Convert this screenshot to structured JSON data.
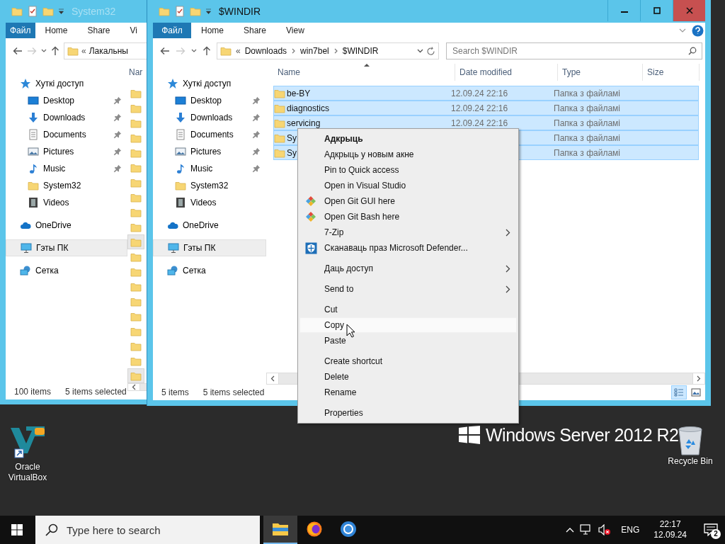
{
  "desktop": {
    "branding": "Windows Server 2012 R2",
    "icons": [
      {
        "label": "Oracle VirtualBox",
        "kind": "virtualbox"
      },
      {
        "label": "Recycle Bin",
        "kind": "bin"
      }
    ]
  },
  "windows": [
    {
      "title": "System32",
      "active": false,
      "help_button": false,
      "ribbon_tabs": [
        {
          "label": "Файл",
          "kind": "file"
        },
        {
          "label": "Home",
          "kind": "tab"
        },
        {
          "label": "Share",
          "kind": "tab"
        },
        {
          "label": "Vi",
          "kind": "tab"
        }
      ],
      "address": {
        "overflow": "«",
        "crumbs": [
          "Лакальны"
        ]
      },
      "nav": [
        {
          "label": "Хуткі доступ",
          "kind": "quick",
          "selected": false,
          "pinned": false,
          "children": [
            {
              "label": "Desktop",
              "kind": "desktop",
              "selected": false,
              "pinned": true
            },
            {
              "label": "Downloads",
              "kind": "downloads",
              "selected": false,
              "pinned": true
            },
            {
              "label": "Documents",
              "kind": "documents",
              "selected": false,
              "pinned": true
            },
            {
              "label": "Pictures",
              "kind": "pictures",
              "selected": false,
              "pinned": true
            },
            {
              "label": "Music",
              "kind": "music",
              "selected": false,
              "pinned": true
            },
            {
              "label": "System32",
              "kind": "folder",
              "selected": false,
              "pinned": false
            },
            {
              "label": "Videos",
              "kind": "videos",
              "selected": false,
              "pinned": false
            }
          ]
        },
        {
          "label": "OneDrive",
          "kind": "cloud",
          "selected": false,
          "pinned": false
        },
        {
          "label": "Гэты ПК",
          "kind": "computer",
          "selected": true,
          "pinned": false
        },
        {
          "label": "Сетка",
          "kind": "network",
          "selected": false,
          "pinned": false
        }
      ],
      "columns": [
        {
          "label": "Nar",
          "sorted": false
        }
      ],
      "files": [
        {
          "selected": false
        },
        {
          "selected": false
        },
        {
          "selected": false
        },
        {
          "selected": false
        },
        {
          "selected": false
        },
        {
          "selected": false
        },
        {
          "selected": false
        },
        {
          "selected": false
        },
        {
          "selected": false
        },
        {
          "selected": false
        },
        {
          "selected": true
        },
        {
          "selected": false
        },
        {
          "selected": false
        },
        {
          "selected": false
        },
        {
          "selected": false
        },
        {
          "selected": false
        },
        {
          "selected": false
        },
        {
          "selected": false
        },
        {
          "selected": false
        },
        {
          "selected": true
        }
      ],
      "status": [
        "100 items",
        "5 items selected"
      ]
    },
    {
      "title": "$WINDIR",
      "active": true,
      "help_button": true,
      "controls": [
        {
          "kind": "minimize"
        },
        {
          "kind": "maximize"
        },
        {
          "kind": "close"
        }
      ],
      "ribbon_tabs": [
        {
          "label": "Файл",
          "kind": "file"
        },
        {
          "label": "Home",
          "kind": "tab"
        },
        {
          "label": "Share",
          "kind": "tab"
        },
        {
          "label": "View",
          "kind": "tab"
        }
      ],
      "address": {
        "overflow": "«",
        "crumbs": [
          "Downloads",
          "win7bel",
          "$WINDIR"
        ]
      },
      "search": {
        "placeholder": "Search $WINDIR"
      },
      "nav": [
        {
          "label": "Хуткі доступ",
          "kind": "quick",
          "selected": false,
          "pinned": false,
          "children": [
            {
              "label": "Desktop",
              "kind": "desktop",
              "selected": false,
              "pinned": true
            },
            {
              "label": "Downloads",
              "kind": "downloads",
              "selected": false,
              "pinned": true
            },
            {
              "label": "Documents",
              "kind": "documents",
              "selected": false,
              "pinned": true
            },
            {
              "label": "Pictures",
              "kind": "pictures",
              "selected": false,
              "pinned": true
            },
            {
              "label": "Music",
              "kind": "music",
              "selected": false,
              "pinned": true
            },
            {
              "label": "System32",
              "kind": "folder",
              "selected": false,
              "pinned": false
            },
            {
              "label": "Videos",
              "kind": "videos",
              "selected": false,
              "pinned": false
            }
          ]
        },
        {
          "label": "OneDrive",
          "kind": "cloud",
          "selected": false,
          "pinned": false
        },
        {
          "label": "Гэты ПК",
          "kind": "computer",
          "selected": true,
          "pinned": false
        },
        {
          "label": "Сетка",
          "kind": "network",
          "selected": false,
          "pinned": false
        }
      ],
      "columns": [
        {
          "label": "Name",
          "sorted": true
        },
        {
          "label": "Date modified",
          "sorted": false
        },
        {
          "label": "Type",
          "sorted": false
        },
        {
          "label": "Size",
          "sorted": false
        }
      ],
      "files": [
        {
          "name": "be-BY",
          "date": "12.09.24 22:16",
          "type": "Папка з файламі",
          "selected": true
        },
        {
          "name": "diagnostics",
          "date": "12.09.24 22:16",
          "type": "Папка з файламі",
          "selected": true
        },
        {
          "name": "servicing",
          "date": "12.09.24 22:16",
          "type": "Папка з файламі",
          "selected": true
        },
        {
          "name": "Sy",
          "type": "Папка з файламі",
          "selected": true
        },
        {
          "name": "Sy",
          "type": "Папка з файламі",
          "selected": true
        }
      ],
      "status": [
        "5 items",
        "5 items selected"
      ],
      "views": [
        {
          "kind": "details",
          "selected": true
        },
        {
          "kind": "tiles",
          "selected": false
        }
      ]
    }
  ],
  "context_menu": [
    {
      "label": "Адкрыць",
      "kind": "plain",
      "default": true,
      "submenu": false,
      "highlighted": false
    },
    {
      "label": "Адкрыць у новым акне",
      "kind": "plain",
      "default": false,
      "submenu": false,
      "highlighted": false
    },
    {
      "label": "Pin to Quick access",
      "kind": "plain",
      "default": false,
      "submenu": false,
      "highlighted": false
    },
    {
      "label": "Open in Visual Studio",
      "kind": "plain",
      "default": false,
      "submenu": false,
      "highlighted": false
    },
    {
      "label": "Open Git GUI here",
      "kind": "git",
      "default": false,
      "submenu": false,
      "highlighted": false
    },
    {
      "label": "Open Git Bash here",
      "kind": "git",
      "default": false,
      "submenu": false,
      "highlighted": false
    },
    {
      "label": "7-Zip",
      "kind": "plain",
      "default": false,
      "submenu": true,
      "highlighted": false
    },
    {
      "label": "Сканаваць праз Microsoft Defender...",
      "kind": "shield",
      "default": false,
      "submenu": false,
      "highlighted": false
    },
    {
      "kind": "separator"
    },
    {
      "label": "Даць доступ",
      "kind": "plain",
      "default": false,
      "submenu": true,
      "highlighted": false
    },
    {
      "kind": "separator"
    },
    {
      "label": "Send to",
      "kind": "plain",
      "default": false,
      "submenu": true,
      "highlighted": false
    },
    {
      "kind": "separator"
    },
    {
      "label": "Cut",
      "kind": "plain",
      "default": false,
      "submenu": false,
      "highlighted": false
    },
    {
      "label": "Copy",
      "kind": "plain",
      "default": false,
      "submenu": false,
      "highlighted": true
    },
    {
      "label": "Paste",
      "kind": "plain",
      "default": false,
      "submenu": false,
      "highlighted": false
    },
    {
      "kind": "separator"
    },
    {
      "label": "Create shortcut",
      "kind": "plain",
      "default": false,
      "submenu": false,
      "highlighted": false
    },
    {
      "label": "Delete",
      "kind": "plain",
      "default": false,
      "submenu": false,
      "highlighted": false
    },
    {
      "label": "Rename",
      "kind": "plain",
      "default": false,
      "submenu": false,
      "highlighted": false
    },
    {
      "kind": "separator"
    },
    {
      "label": "Properties",
      "kind": "plain",
      "default": false,
      "submenu": false,
      "highlighted": false
    }
  ],
  "taskbar": {
    "search_placeholder": "Type here to search",
    "apps": [
      {
        "kind": "explorer",
        "active": true
      },
      {
        "kind": "firefox",
        "active": false
      },
      {
        "kind": "chrome",
        "active": false
      }
    ],
    "volume_muted": true,
    "language": "ENG",
    "time": "22:17",
    "date": "12.09.24",
    "notifications": "2"
  }
}
